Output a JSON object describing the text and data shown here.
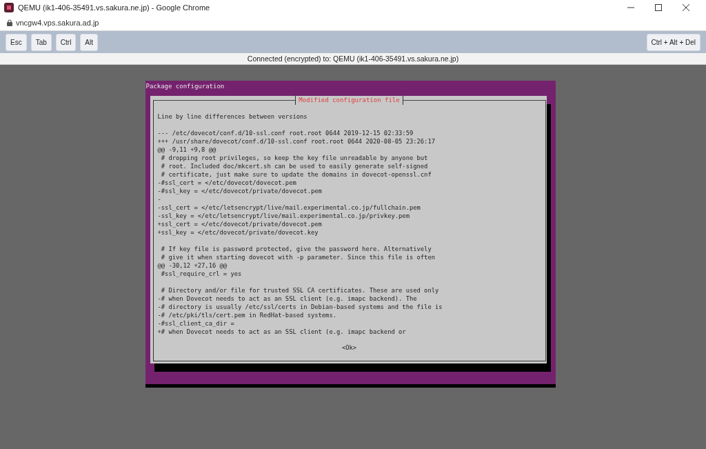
{
  "window": {
    "title": "QEMU (ik1-406-35491.vs.sakura.ne.jp) - Google Chrome"
  },
  "address_bar": {
    "url": "vncgw4.vps.sakura.ad.jp"
  },
  "toolbar": {
    "left_keys": [
      "Esc",
      "Tab",
      "Ctrl",
      "Alt"
    ],
    "right_keys": [
      "Ctrl + Alt + Del"
    ]
  },
  "status_line": "Connected (encrypted) to: QEMU (ik1-406-35491.vs.sakura.ne.jp)",
  "console": {
    "backtitle": "Package configuration",
    "dialog": {
      "title": "Modified configuration file",
      "blocks": [
        {
          "lines": [
            "Line by line differences between versions"
          ]
        },
        {
          "lines": [
            "--- /etc/dovecot/conf.d/10-ssl.conf root.root 0644 2019-12-15 02:33:59",
            "+++ /usr/share/dovecot/conf.d/10-ssl.conf root.root 0644 2020-08-05 23:26:17",
            "@@ -9,11 +9,8 @@",
            " # dropping root privileges, so keep the key file unreadable by anyone but",
            " # root. Included doc/mkcert.sh can be used to easily generate self-signed",
            " # certificate, just make sure to update the domains in dovecot-openssl.cnf",
            "-#ssl_cert = </etc/dovecot/dovecot.pem",
            "-#ssl_key = </etc/dovecot/private/dovecot.pem",
            "-",
            "-ssl_cert = </etc/letsencrypt/live/mail.experimental.co.jp/fullchain.pem",
            "-ssl_key = </etc/letsencrypt/live/mail.experimental.co.jp/privkey.pem",
            "+ssl_cert = </etc/dovecot/private/dovecot.pem",
            "+ssl_key = </etc/dovecot/private/dovecot.key"
          ]
        },
        {
          "lines": [
            " # If key file is password protected, give the password here. Alternatively",
            " # give it when starting dovecot with -p parameter. Since this file is often",
            "@@ -30,12 +27,16 @@",
            " #ssl_require_crl = yes"
          ]
        },
        {
          "lines": [
            " # Directory and/or file for trusted SSL CA certificates. These are used only",
            "-# when Dovecot needs to act as an SSL client (e.g. imapc backend). The",
            "-# directory is usually /etc/ssl/certs in Debian-based systems and the file is",
            "-# /etc/pki/tls/cert.pem in RedHat-based systems.",
            "-#ssl_client_ca_dir =",
            "+# when Dovecot needs to act as an SSL client (e.g. imapc backend or"
          ]
        }
      ],
      "button": "<Ok>"
    }
  }
}
